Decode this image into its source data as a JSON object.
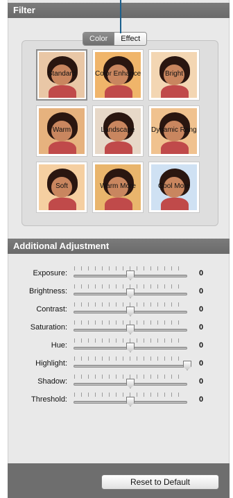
{
  "filter": {
    "title": "Filter",
    "tabs": [
      {
        "label": "Color",
        "active": true
      },
      {
        "label": "Effect",
        "active": false
      }
    ],
    "presets": [
      {
        "label": "Standard",
        "tint": "#e9c7a6"
      },
      {
        "label": "Color Enhance",
        "tint": "#f0b56a"
      },
      {
        "label": "Bright",
        "tint": "#f3d6b3"
      },
      {
        "label": "Warm",
        "tint": "#e6b27e"
      },
      {
        "label": "Landscape",
        "tint": "#e7d8c8"
      },
      {
        "label": "Dynamic Range",
        "tint": "#f0c28f"
      },
      {
        "label": "Soft",
        "tint": "#f5cfa1"
      },
      {
        "label": "Warm More",
        "tint": "#e9b56c"
      },
      {
        "label": "Cool More",
        "tint": "#cfe1f3"
      }
    ]
  },
  "adjustment": {
    "title": "Additional Adjustment",
    "sliders": [
      {
        "label": "Exposure:",
        "value": "0",
        "fraction": 0.5
      },
      {
        "label": "Brightness:",
        "value": "0",
        "fraction": 0.5
      },
      {
        "label": "Contrast:",
        "value": "0",
        "fraction": 0.5
      },
      {
        "label": "Saturation:",
        "value": "0",
        "fraction": 0.5
      },
      {
        "label": "Hue:",
        "value": "0",
        "fraction": 0.5
      },
      {
        "label": "Highlight:",
        "value": "0",
        "fraction": 1.0
      },
      {
        "label": "Shadow:",
        "value": "0",
        "fraction": 0.5
      },
      {
        "label": "Threshold:",
        "value": "0",
        "fraction": 0.5
      }
    ]
  },
  "footer": {
    "reset_label": "Reset to Default"
  },
  "colors": {
    "header_bg": "#6e6e6e",
    "panel_bg": "#e9e9e9",
    "pointer": "#1b5f8c"
  }
}
